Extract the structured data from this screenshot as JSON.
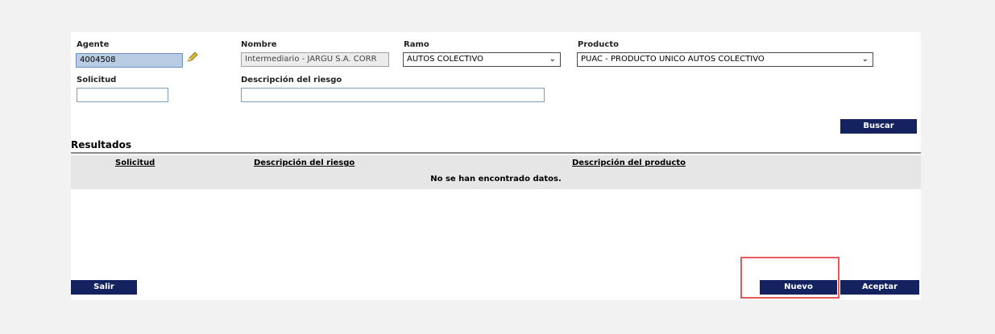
{
  "form": {
    "agente": {
      "label": "Agente",
      "value": "4004508"
    },
    "nombre": {
      "label": "Nombre",
      "value": "Intermediario - JARGU S.A. CORR"
    },
    "ramo": {
      "label": "Ramo",
      "value": "AUTOS COLECTIVO"
    },
    "producto": {
      "label": "Producto",
      "value": "PUAC - PRODUCTO UNICO AUTOS COLECTIVO"
    },
    "solicitud": {
      "label": "Solicitud",
      "value": ""
    },
    "descripcion": {
      "label": "Descripción del riesgo",
      "value": ""
    },
    "buscar_label": "Buscar"
  },
  "results": {
    "title": "Resultados",
    "columns": [
      "Solicitud",
      "Descripción del riesgo",
      "Descripción del producto"
    ],
    "empty_message": "No se han encontrado datos."
  },
  "footer": {
    "salir_label": "Salir",
    "nuevo_label": "Nuevo",
    "aceptar_label": "Aceptar"
  },
  "colors": {
    "button_bg": "#14235f",
    "highlight": "#e25a5a",
    "agent_field_bg": "#b8cce4"
  }
}
